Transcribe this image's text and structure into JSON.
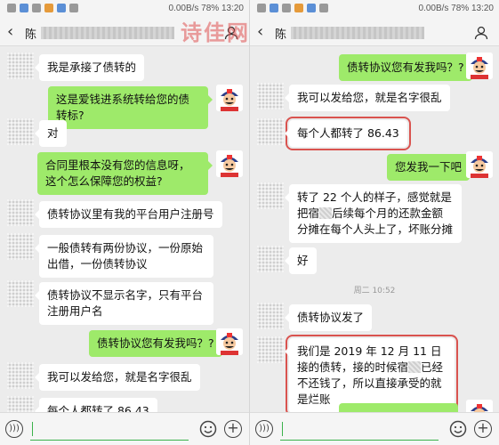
{
  "watermark": "诗佳网",
  "left": {
    "status": {
      "right_text": "0.00B/s  78%  13:20"
    },
    "title": "陈",
    "messages": [
      {
        "text": "我是承接了债转的"
      },
      {
        "text": "这是爱钱进系统转给您的债转标?"
      },
      {
        "text": "对"
      },
      {
        "text": "合同里根本没有您的信息呀，这个怎么保障您的权益?"
      },
      {
        "text": "债转协议里有我的平台用户注册号"
      },
      {
        "text": "一般债转有两份协议，一份原始出借，一份债转协议"
      },
      {
        "text": "债转协议不显示名字，只有平台注册用户名"
      },
      {
        "text": "债转协议您有发我吗？?"
      },
      {
        "text": "我可以发给您，就是名字很乱"
      },
      {
        "text": "每个人都转了 86.43"
      }
    ]
  },
  "right": {
    "status": {
      "right_text": "0.00B/s  78%  13:20"
    },
    "title": "陈",
    "messages": [
      {
        "text": "债转协议您有发我吗？?"
      },
      {
        "text": "我可以发给您，就是名字很乱"
      },
      {
        "text": "每个人都转了 86.43"
      },
      {
        "text": "您发我一下吧"
      },
      {
        "text_a": "转了 22 个人的样子，感觉就是把宿",
        "text_b": "后续每个月的还款金额分摊在每个人头上了，坏账分摊"
      },
      {
        "text": "好"
      },
      {
        "text": "债转协议发了"
      },
      {
        "text_a": "我们是 2019 年 12 月 11 日接的债转，接的时候宿",
        "text_b": "已经不还钱了，所以直接承受的就是烂账"
      }
    ],
    "timestamp": "周二 10:52"
  }
}
